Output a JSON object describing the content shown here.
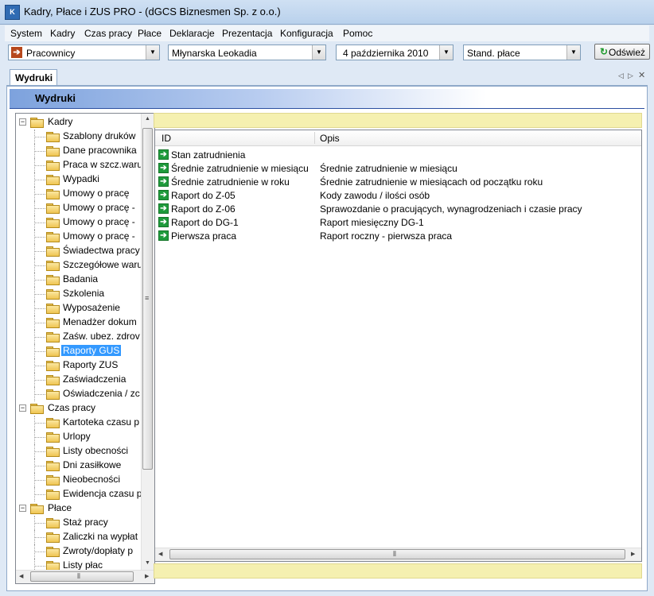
{
  "window": {
    "title": "Kadry, Płace i ZUS PRO - (dGCS Biznesmen Sp. z o.o.)",
    "icon_text": "K"
  },
  "menu": [
    "System",
    "Kadry",
    "Czas pracy",
    "Płace",
    "Deklaracje",
    "Prezentacja",
    "Konfiguracja",
    "Pomoc"
  ],
  "toolbar": {
    "module": "Pracownicy",
    "employee": "Młynarska Leokadia",
    "date": "4 października 2010",
    "mode": "Stand. płace",
    "refresh_label": "Odśwież"
  },
  "tabs": [
    {
      "label": "Wydruki"
    }
  ],
  "section": {
    "title": "Wydruki"
  },
  "tree": [
    {
      "label": "Kadry",
      "level": 0
    },
    {
      "label": "Szablony druków",
      "level": 1
    },
    {
      "label": "Dane pracownika",
      "level": 1
    },
    {
      "label": "Praca w szcz.waru",
      "level": 1
    },
    {
      "label": "Wypadki",
      "level": 1
    },
    {
      "label": "Umowy o pracę",
      "level": 1
    },
    {
      "label": "Umowy o pracę -",
      "level": 1
    },
    {
      "label": "Umowy o pracę -",
      "level": 1
    },
    {
      "label": "Umowy o pracę -",
      "level": 1
    },
    {
      "label": "Świadectwa pracy",
      "level": 1
    },
    {
      "label": "Szczegółowe waru",
      "level": 1
    },
    {
      "label": "Badania",
      "level": 1
    },
    {
      "label": "Szkolenia",
      "level": 1
    },
    {
      "label": "Wyposażenie",
      "level": 1
    },
    {
      "label": "Menadżer dokum",
      "level": 1
    },
    {
      "label": "Zaśw. ubez. zdrov",
      "level": 1
    },
    {
      "label": "Raporty GUS",
      "level": 1,
      "selected": true
    },
    {
      "label": "Raporty ZUS",
      "level": 1
    },
    {
      "label": "Zaświadczenia",
      "level": 1
    },
    {
      "label": "Oświadczenia / zc",
      "level": 1
    },
    {
      "label": "Czas pracy",
      "level": 0
    },
    {
      "label": "Kartoteka czasu p",
      "level": 1
    },
    {
      "label": "Urlopy",
      "level": 1
    },
    {
      "label": "Listy obecności",
      "level": 1
    },
    {
      "label": "Dni zasiłkowe",
      "level": 1
    },
    {
      "label": "Nieobecności",
      "level": 1
    },
    {
      "label": "Ewidencja czasu p",
      "level": 1
    },
    {
      "label": "Płace",
      "level": 0
    },
    {
      "label": "Staż pracy",
      "level": 1
    },
    {
      "label": "Zaliczki na wypłat",
      "level": 1
    },
    {
      "label": "Zwroty/dopłaty p",
      "level": 1
    },
    {
      "label": "Listy płac",
      "level": 1
    }
  ],
  "grid": {
    "columns": [
      "ID",
      "Opis"
    ],
    "rows": [
      {
        "id": "Stan zatrudnienia",
        "opis": ""
      },
      {
        "id": "Średnie zatrudnienie w miesiącu",
        "opis": "Średnie zatrudnienie w miesiącu"
      },
      {
        "id": "Średnie zatrudnienie w roku",
        "opis": "Średnie zatrudnienie w miesiącach od początku roku"
      },
      {
        "id": "Raport do Z-05",
        "opis": "Kody zawodu / ilości osób"
      },
      {
        "id": "Raport do Z-06",
        "opis": "Sprawozdanie o pracujących, wynagrodzeniach i czasie pracy"
      },
      {
        "id": "Raport do DG-1",
        "opis": "Raport miesięczny DG-1"
      },
      {
        "id": "Pierwsza praca",
        "opis": "Raport roczny - pierwsza praca"
      }
    ]
  },
  "icons": {
    "row": "green-arrow-icon",
    "folder": "folder-icon",
    "refresh": "refresh-icon",
    "module": "arrow-right-icon"
  }
}
